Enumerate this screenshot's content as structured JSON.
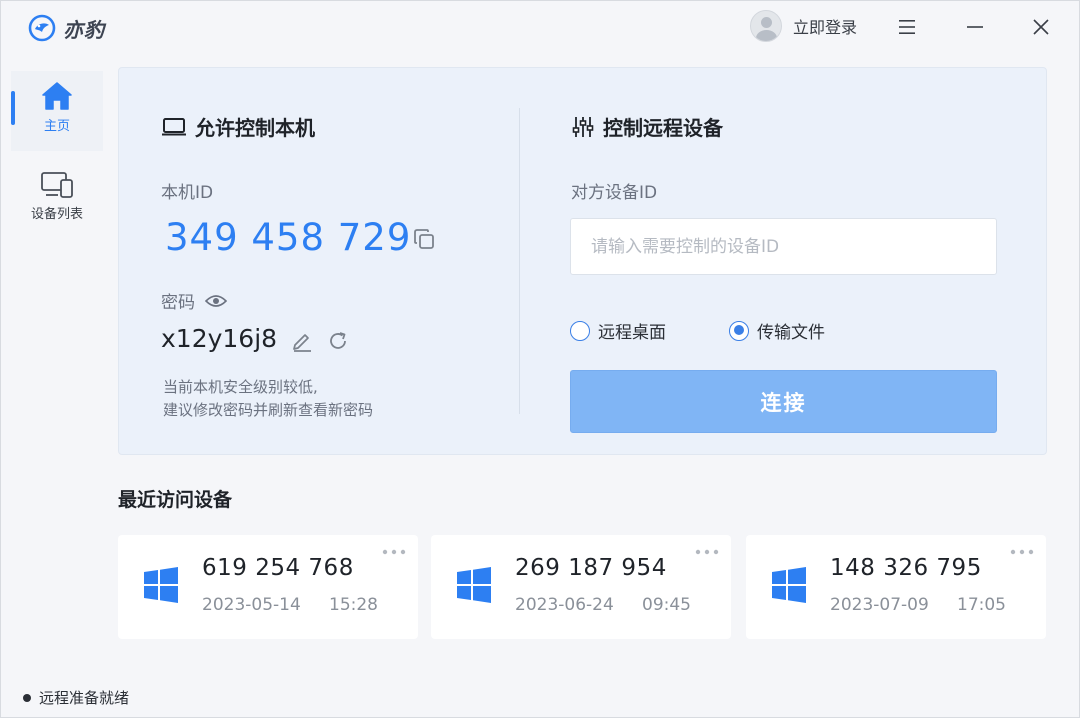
{
  "app": {
    "name": "亦豹"
  },
  "header": {
    "login_label": "立即登录"
  },
  "sidebar": {
    "items": [
      {
        "label": "主页",
        "icon": "home-icon",
        "active": true
      },
      {
        "label": "设备列表",
        "icon": "devices-icon",
        "active": false
      }
    ]
  },
  "local": {
    "title": "允许控制本机",
    "id_label": "本机ID",
    "device_id": "349 458 729",
    "password_label": "密码",
    "password": "x12y16j8",
    "warning_line1": "当前本机安全级别较低,",
    "warning_line2": "建议修改密码并刷新查看新密码"
  },
  "remote": {
    "title": "控制远程设备",
    "id_label": "对方设备ID",
    "placeholder": "请输入需要控制的设备ID",
    "value": "",
    "mode_options": [
      "远程桌面",
      "传输文件"
    ],
    "selected_mode": "传输文件",
    "connect_label": "连接"
  },
  "recent": {
    "title": "最近访问设备",
    "devices": [
      {
        "id": "619 254 768",
        "date": "2023-05-14",
        "time": "15:28",
        "os_icon": "windows-icon"
      },
      {
        "id": "269 187 954",
        "date": "2023-06-24",
        "time": "09:45",
        "os_icon": "windows-icon"
      },
      {
        "id": "148 326 795",
        "date": "2023-07-09",
        "time": "17:05",
        "os_icon": "windows-icon"
      }
    ]
  },
  "status": {
    "text": "远程准备就绪"
  },
  "colors": {
    "accent": "#2d7ff2",
    "connect_button": "#80b5f5",
    "card_bg": "#ebf1fa"
  }
}
